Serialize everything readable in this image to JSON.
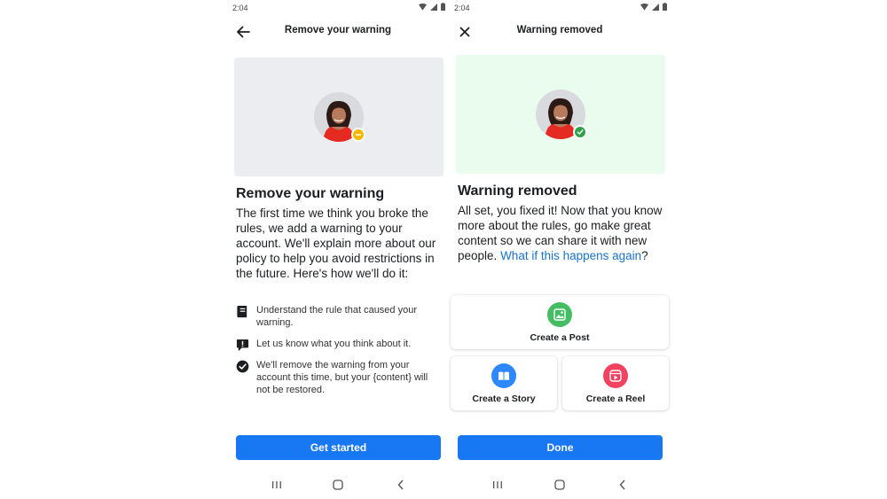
{
  "left_screen": {
    "status": {
      "time": "2:04"
    },
    "appbar": {
      "title": "Remove your warning",
      "back_icon": "arrow-left-icon"
    },
    "heading": "Remove your warning",
    "body": "The first time we think you broke the rules, we add a warning to your account. We'll explain more about our policy to help you avoid restrictions in the future. Here's how we'll do it:",
    "steps": [
      {
        "icon": "book-icon",
        "text": "Understand the rule that caused your warning."
      },
      {
        "icon": "speech-bubble-icon",
        "text": "Let us know what you think about it."
      },
      {
        "icon": "check-circle-icon",
        "text": "We'll remove the warning from your account this time, but your {content} will not be restored."
      }
    ],
    "button": "Get started",
    "badge_color": "#f5b800"
  },
  "right_screen": {
    "status": {
      "time": "2:04"
    },
    "appbar": {
      "title": "Warning removed",
      "close_icon": "close-icon"
    },
    "heading": "Warning removed",
    "body_text": "All set, you fixed it! Now that you know more about the rules, go make great content so we can share it with new people.",
    "body_link": "What if this happens again",
    "body_end": "?",
    "cards": {
      "post": {
        "label": "Create a Post",
        "icon": "photo-icon",
        "color": "#45bd62"
      },
      "story": {
        "label": "Create a Story",
        "icon": "book-open-icon",
        "color": "#2d88ff"
      },
      "reel": {
        "label": "Create a Reel",
        "icon": "reel-icon",
        "color": "#f3425f"
      }
    },
    "button": "Done",
    "badge_color": "#31a24c"
  },
  "colors": {
    "accent": "#1877f2",
    "link": "#1a73c8"
  }
}
